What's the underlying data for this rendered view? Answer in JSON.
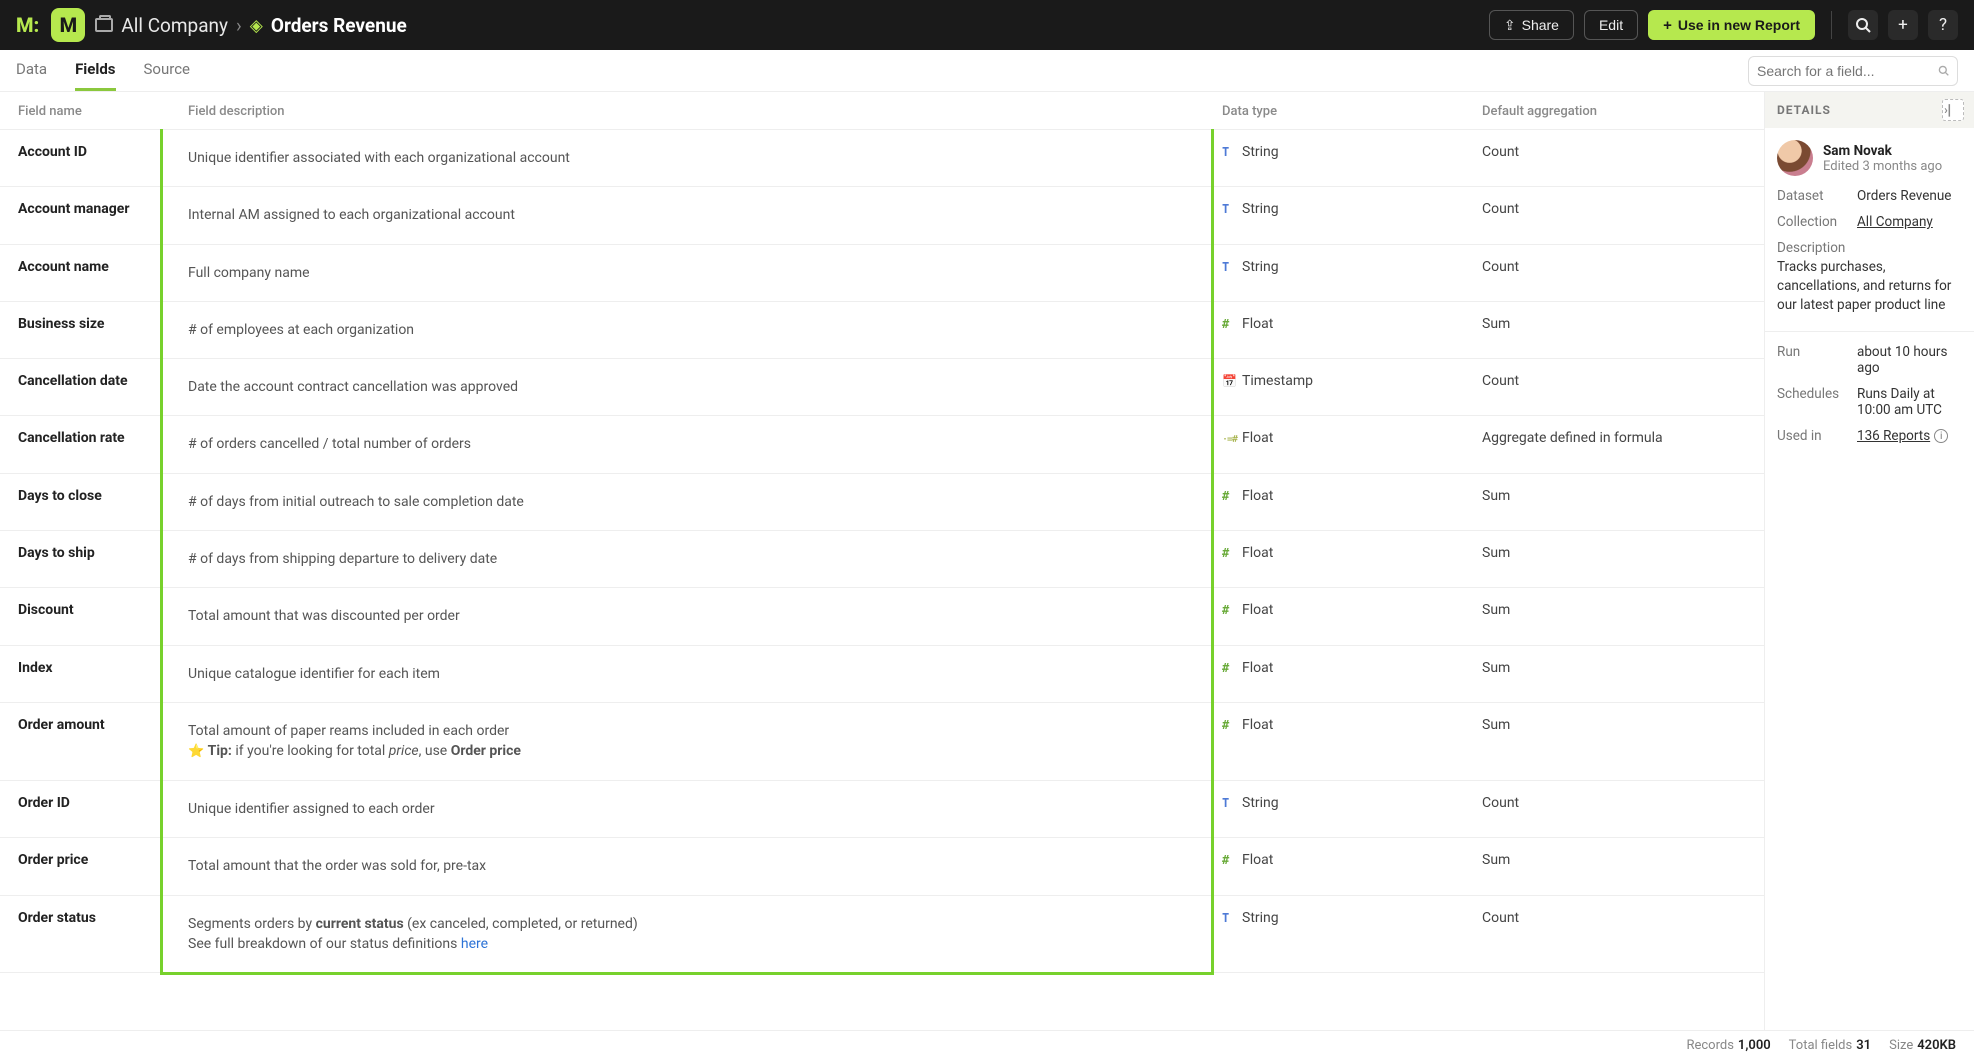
{
  "topbar": {
    "collection_icon": "collection",
    "collection": "All Company",
    "dataset_icon": "dataset-diamond",
    "dataset": "Orders Revenue",
    "share_label": "Share",
    "edit_label": "Edit",
    "new_report_label": "Use in new Report"
  },
  "tabs": {
    "data": "Data",
    "fields": "Fields",
    "source": "Source",
    "active": "fields"
  },
  "search": {
    "placeholder": "Search for a field..."
  },
  "columns": {
    "name": "Field name",
    "desc": "Field description",
    "type": "Data type",
    "agg": "Default aggregation"
  },
  "type_icons": {
    "String": {
      "glyph": "T",
      "cls": "t-str"
    },
    "Float": {
      "glyph": "#",
      "cls": "t-num"
    },
    "Timestamp": {
      "glyph": "📅",
      "cls": "t-ts"
    },
    "Calc": {
      "glyph": "·=#",
      "cls": "t-calc"
    }
  },
  "rows": [
    {
      "name": "Account ID",
      "desc": "Unique identifier associated with each organizational account",
      "type": "String",
      "agg": "Count"
    },
    {
      "name": "Account manager",
      "desc": "Internal AM assigned to each organizational account",
      "type": "String",
      "agg": "Count"
    },
    {
      "name": "Account name",
      "desc": "Full company name",
      "type": "String",
      "agg": "Count"
    },
    {
      "name": "Business size",
      "desc": "# of employees at each organization",
      "type": "Float",
      "agg": "Sum"
    },
    {
      "name": "Cancellation date",
      "desc": "Date the account contract cancellation was approved",
      "type": "Timestamp",
      "agg": "Count"
    },
    {
      "name": "Cancellation rate",
      "desc": "# of orders cancelled / total number of orders",
      "type": "Float",
      "type_variant": "Calc",
      "agg": "Aggregate defined in formula"
    },
    {
      "name": "Days to close",
      "desc": "# of days from initial outreach to sale completion date",
      "type": "Float",
      "agg": "Sum"
    },
    {
      "name": "Days to ship",
      "desc": "# of days from shipping departure to delivery date",
      "type": "Float",
      "agg": "Sum"
    },
    {
      "name": "Discount",
      "desc": "Total amount that was discounted per order",
      "type": "Float",
      "agg": "Sum"
    },
    {
      "name": "Index",
      "desc": "Unique catalogue identifier for each item",
      "type": "Float",
      "agg": "Sum"
    },
    {
      "name": "Order amount",
      "desc_html": "Total amount of paper reams included in each order<br><span class='emoji'>⭐</span> <span class='bold'>Tip:</span> if you're looking for total <span class='ital'>price</span>, use <span class='bold'>Order price</span>",
      "type": "Float",
      "agg": "Sum"
    },
    {
      "name": "Order ID",
      "desc": "Unique identifier assigned to each order",
      "type": "String",
      "agg": "Count"
    },
    {
      "name": "Order price",
      "desc": "Total amount that the order was sold for, pre-tax",
      "type": "Float",
      "agg": "Sum"
    },
    {
      "name": "Order status",
      "desc_html": "Segments orders by <span class='bold'>current status</span> (ex canceled, completed, or returned)<br>See full breakdown of our status definitions <a class='link'>here</a>",
      "type": "String",
      "agg": "Count"
    }
  ],
  "details": {
    "header": "DETAILS",
    "user_name": "Sam Novak",
    "user_sub": "Edited 3 months ago",
    "dataset_k": "Dataset",
    "dataset_v": "Orders Revenue",
    "collection_k": "Collection",
    "collection_v": "All Company",
    "desc_k": "Description",
    "desc_v": "Tracks purchases, cancellations, and returns for our latest paper product line",
    "run_k": "Run",
    "run_v": "about 10 hours ago",
    "sched_k": "Schedules",
    "sched_v": "Runs Daily at 10:00 am UTC",
    "used_k": "Used in",
    "used_v": "136 Reports"
  },
  "footer": {
    "records_k": "Records",
    "records_v": "1,000",
    "fields_k": "Total fields",
    "fields_v": "31",
    "size_k": "Size",
    "size_v": "420KB"
  }
}
